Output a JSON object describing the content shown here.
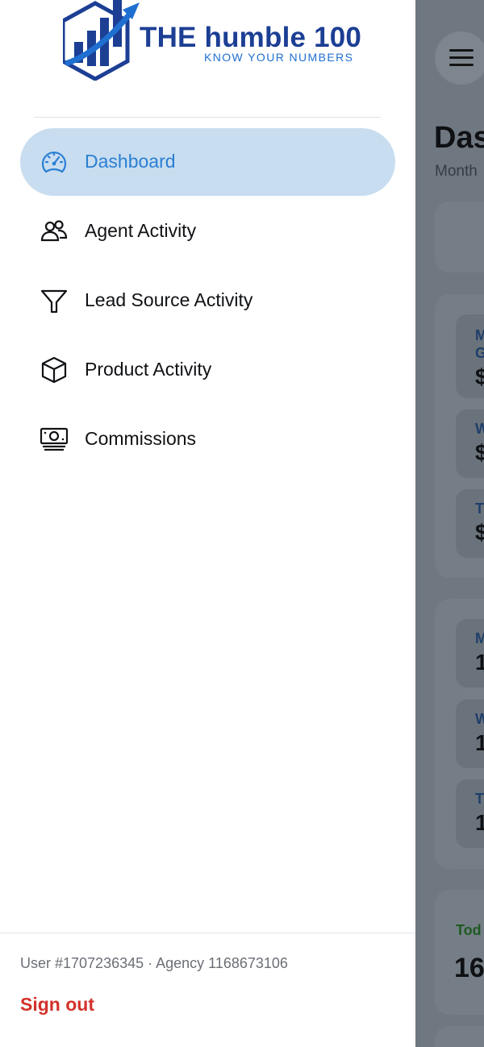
{
  "brand": {
    "title": "THE humble 100",
    "tagline": "KNOW YOUR NUMBERS",
    "colors": {
      "dark_blue": "#1c3f94",
      "light_blue": "#1f6fd1"
    }
  },
  "nav": {
    "items": [
      {
        "label": "Dashboard",
        "icon": "speedometer-icon",
        "active": true
      },
      {
        "label": "Agent Activity",
        "icon": "people-icon",
        "active": false
      },
      {
        "label": "Lead Source Activity",
        "icon": "funnel-icon",
        "active": false
      },
      {
        "label": "Product Activity",
        "icon": "box-icon",
        "active": false
      },
      {
        "label": "Commissions",
        "icon": "cash-icon",
        "active": false
      }
    ]
  },
  "footer": {
    "user_info": "User #1707236345 · Agency 1168673106",
    "signout_label": "Sign out"
  },
  "background": {
    "title_partial": "Das",
    "subtitle_partial": "Month",
    "card1": {
      "labels": [
        "M",
        "G",
        "W",
        "T"
      ],
      "values": [
        "$",
        "$",
        "$"
      ]
    },
    "card2": {
      "labels": [
        "M",
        "W",
        "T"
      ],
      "values": [
        "1",
        "1",
        "1"
      ]
    },
    "card3": {
      "label": "Tod",
      "value": "16"
    }
  },
  "colors": {
    "accent": "#2a7fd4",
    "active_bg": "#c8ddf0",
    "signout": "#d3322b",
    "overlay": "#6f7881"
  }
}
